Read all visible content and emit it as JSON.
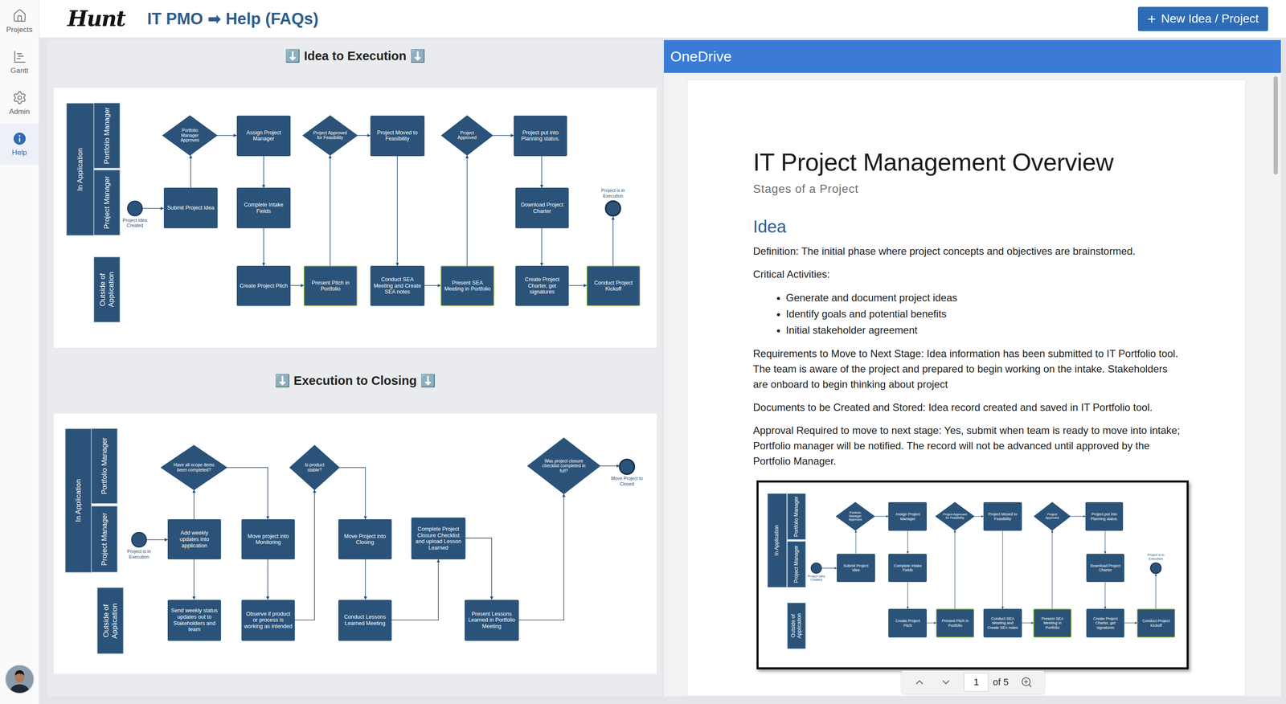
{
  "app": {
    "logo": "Hunt",
    "title": "IT PMO ➡ Help (FAQs)",
    "new_button": {
      "icon": "+",
      "label": "New Idea / Project"
    }
  },
  "sidebar": {
    "items": [
      {
        "label": "Projects",
        "selected": false
      },
      {
        "label": "Gantt",
        "selected": false
      },
      {
        "label": "Admin",
        "selected": false
      },
      {
        "label": "Help",
        "selected": true
      }
    ]
  },
  "diagrams": [
    {
      "title": "⬇️ Idea to Execution ⬇️",
      "lanes": [
        "In Application",
        "Portfolio Manager",
        "Project Manager",
        "Outside of Application"
      ],
      "nodes": [
        {
          "kind": "start",
          "label": "Project Idea Created",
          "highlighted": false
        },
        {
          "kind": "task",
          "label": "Submit Project Idea",
          "highlighted": false
        },
        {
          "kind": "decision",
          "label": "Portfolio Manager Approves",
          "highlighted": false
        },
        {
          "kind": "task",
          "label": "Assign Project Manager",
          "highlighted": false
        },
        {
          "kind": "task",
          "label": "Complete Intake Fields",
          "highlighted": false
        },
        {
          "kind": "task",
          "label": "Create Project Pitch",
          "highlighted": false
        },
        {
          "kind": "task",
          "label": "Present Pitch in Portfolio",
          "highlighted": true
        },
        {
          "kind": "decision",
          "label": "Project Approved for Feasibility",
          "highlighted": false
        },
        {
          "kind": "task",
          "label": "Project Moved to Feasibility",
          "highlighted": false
        },
        {
          "kind": "task",
          "label": "Conduct SEA Meeting and Create SEA notes",
          "highlighted": false
        },
        {
          "kind": "task",
          "label": "Present SEA Meeting in Portfolio",
          "highlighted": true
        },
        {
          "kind": "decision",
          "label": "Project Approved",
          "highlighted": false
        },
        {
          "kind": "task",
          "label": "Project put into Planning status.",
          "highlighted": false
        },
        {
          "kind": "task",
          "label": "Download Project Charter",
          "highlighted": false
        },
        {
          "kind": "task",
          "label": "Create Project Charter, get signatures",
          "highlighted": false
        },
        {
          "kind": "task",
          "label": "Conduct Project Kickoff",
          "highlighted": true
        },
        {
          "kind": "end",
          "label": "Project is in Execution",
          "highlighted": false
        }
      ]
    },
    {
      "title": "⬇️ Execution to Closing ⬇️",
      "lanes": [
        "In Application",
        "Portfolio Manager",
        "Project Manager",
        "Outside of Application"
      ],
      "nodes": [
        {
          "kind": "start",
          "label": "Project is in Execution",
          "highlighted": false
        },
        {
          "kind": "task",
          "label": "Add weekly updates into application",
          "highlighted": false
        },
        {
          "kind": "decision",
          "label": "Have all scope items been completed?",
          "highlighted": false
        },
        {
          "kind": "task",
          "label": "Send weekly status updates out to Stakeholders and team",
          "highlighted": false
        },
        {
          "kind": "task",
          "label": "Move project into Monitoring",
          "highlighted": false
        },
        {
          "kind": "task",
          "label": "Observe if product or process is working as intended",
          "highlighted": false
        },
        {
          "kind": "decision",
          "label": "Is product stable?",
          "highlighted": false
        },
        {
          "kind": "task",
          "label": "Move Project into Closing",
          "highlighted": false
        },
        {
          "kind": "task",
          "label": "Conduct Lessons Learned Meeting",
          "highlighted": false
        },
        {
          "kind": "task",
          "label": "Complete Project Closure Checklist and upload Lesson Learned",
          "highlighted": false
        },
        {
          "kind": "task",
          "label": "Present Lessons Learned in Portfolio Meeting",
          "highlighted": false
        },
        {
          "kind": "decision",
          "label": "Was project closure checklist completed in full?",
          "highlighted": false
        },
        {
          "kind": "end",
          "label": "Move Project to Closed",
          "highlighted": false
        }
      ]
    }
  ],
  "viewer": {
    "title": "OneDrive"
  },
  "document": {
    "title": "IT Project Management Overview",
    "subtitle": "Stages of a Project",
    "sections": [
      {
        "heading": "Idea",
        "blocks": [
          {
            "kind": "para",
            "text": "Definition: The initial phase where project concepts and objectives are brainstormed."
          },
          {
            "kind": "para",
            "text": "Critical Activities:"
          },
          {
            "kind": "list",
            "items": [
              "Generate and document project ideas",
              "Identify goals and potential benefits",
              "Initial stakeholder agreement"
            ]
          },
          {
            "kind": "para",
            "text": "Requirements to Move to Next Stage: Idea information has been submitted to IT Portfolio tool. The team is aware of the project and prepared to begin working on the intake. Stakeholders are onboard to begin thinking about project"
          },
          {
            "kind": "para",
            "text": "Documents to be Created and Stored: Idea record created and saved in IT Portfolio tool."
          },
          {
            "kind": "para",
            "text": "Approval Required to move to next stage: Yes, submit when team is ready to move into intake; Portfolio manager will be notified. The record will not be advanced until approved by the Portfolio Manager."
          },
          {
            "kind": "figure"
          }
        ]
      }
    ]
  },
  "pager": {
    "page": "1",
    "total": "of 5"
  }
}
